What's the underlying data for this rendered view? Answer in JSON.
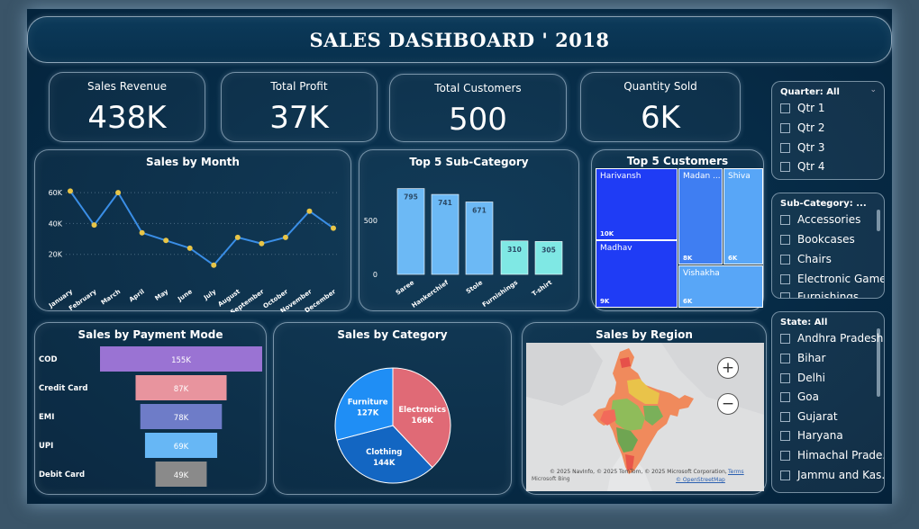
{
  "title": "SALES DASHBOARD ' 2018",
  "kpis": [
    {
      "label": "Sales Revenue",
      "value": "438K"
    },
    {
      "label": "Total Profit",
      "value": "37K"
    },
    {
      "label": "Total Customers",
      "value": "500"
    },
    {
      "label": "Quantity Sold",
      "value": "6K"
    }
  ],
  "month_chart": {
    "title": "Sales by Month",
    "chart_data": {
      "type": "line",
      "x": [
        "January",
        "February",
        "March",
        "April",
        "May",
        "June",
        "July",
        "August",
        "September",
        "October",
        "November",
        "December"
      ],
      "y": [
        61000,
        39000,
        60000,
        34000,
        29000,
        24000,
        13000,
        31000,
        27000,
        31000,
        48000,
        37000
      ],
      "yticks": [
        "20K",
        "40K",
        "60K"
      ],
      "ylim": [
        0,
        70000
      ],
      "color": "#3a8ee6",
      "marker_color": "#e8c547"
    }
  },
  "subcat_chart": {
    "title": "Top 5 Sub-Category",
    "chart_data": {
      "type": "bar",
      "categories": [
        "Saree",
        "Hankerchief",
        "Stole",
        "Furnishings",
        "T-shirt"
      ],
      "values": [
        795,
        741,
        671,
        310,
        305
      ],
      "labels": [
        "795",
        "741",
        "671",
        "310",
        "305"
      ],
      "yticks": [
        "0",
        "500"
      ],
      "ylim": [
        0,
        900
      ],
      "colors": [
        "#6cb9f5",
        "#6cb9f5",
        "#6cb9f5",
        "#7fe8e4",
        "#7fe8e4"
      ]
    }
  },
  "customers": {
    "title": "Top 5 Customers",
    "tiles": [
      {
        "name": "Harivansh",
        "value": "10K",
        "color": "#1f3cf5"
      },
      {
        "name": "Madhav",
        "value": "9K",
        "color": "#1f3cf5"
      },
      {
        "name": "Madan ...",
        "value": "8K",
        "color": "#3f7ef2"
      },
      {
        "name": "Shiva",
        "value": "6K",
        "color": "#58a6f7"
      },
      {
        "name": "Vishakha",
        "value": "6K",
        "color": "#58a6f7"
      }
    ]
  },
  "payment_chart": {
    "title": "Sales by Payment Mode",
    "chart_data": {
      "type": "bar",
      "categories": [
        "COD",
        "Credit Card",
        "EMI",
        "UPI",
        "Debit Card"
      ],
      "values": [
        155,
        87,
        78,
        69,
        49
      ],
      "labels": [
        "155K",
        "87K",
        "78K",
        "69K",
        "49K"
      ],
      "colors": [
        "#9a73d3",
        "#e8949e",
        "#6e7cc8",
        "#67b7f5",
        "#8a8a8a"
      ]
    }
  },
  "category_chart": {
    "title": "Sales by Category",
    "chart_data": {
      "type": "pie",
      "categories": [
        "Electronics",
        "Clothing",
        "Furniture"
      ],
      "values": [
        166,
        144,
        127
      ],
      "labels": [
        "166K",
        "144K",
        "127K"
      ],
      "colors": [
        "#e06a76",
        "#1366c2",
        "#1f8ef5"
      ]
    }
  },
  "region": {
    "title": "Sales by Region",
    "zoom_in": "+",
    "zoom_out": "−",
    "attribution": "© 2025 NavInfo, © 2025 TomTom, © 2025 Microsoft Corporation,",
    "terms": "Terms",
    "osm": "© OpenStreetMap",
    "logo": "Microsoft Bing"
  },
  "slicers": {
    "quarter": {
      "header": "Quarter: All",
      "items": [
        "Qtr 1",
        "Qtr 2",
        "Qtr 3",
        "Qtr 4"
      ]
    },
    "subcategory": {
      "header": "Sub-Category: ...",
      "items": [
        "Accessories",
        "Bookcases",
        "Chairs",
        "Electronic Games",
        "Furnishings"
      ]
    },
    "state": {
      "header": "State: All",
      "items": [
        "Andhra Pradesh",
        "Bihar",
        "Delhi",
        "Goa",
        "Gujarat",
        "Haryana",
        "Himachal Prade...",
        "Jammu and Kas..."
      ]
    }
  }
}
